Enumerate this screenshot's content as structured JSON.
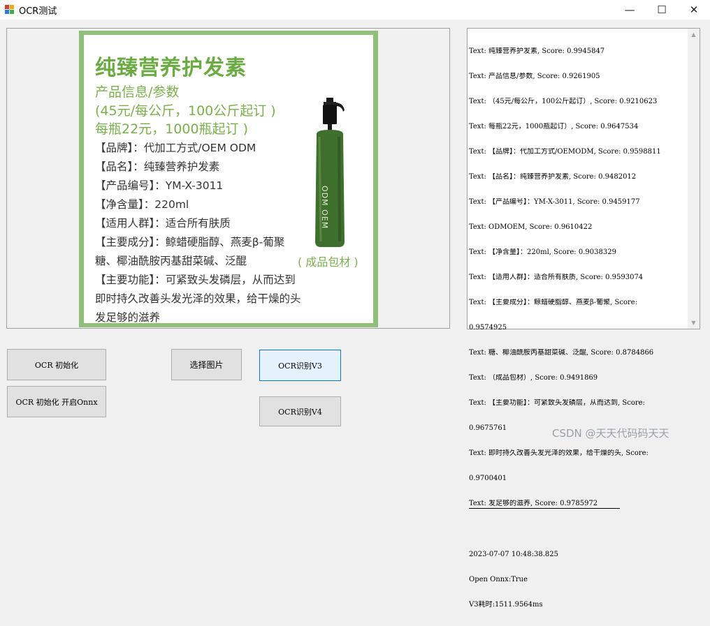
{
  "window": {
    "title": "OCR测试",
    "controls": {
      "minimize": "—",
      "maximize": "☐",
      "close": "✕"
    }
  },
  "product_image": {
    "title": "纯臻营养护发素",
    "sub1": "产品信息/参数",
    "sub2": "(45元/每公斤，100公斤起订 )",
    "sub3": "每瓶22元，1000瓶起订 )",
    "lines": [
      "【品牌】：代加工方式/OEM ODM",
      "【品名】：纯臻营养护发素",
      "【产品编号】：YM-X-3011",
      "【净含量】：220ml",
      "【适用人群】：适合所有肤质",
      "【主要成分】：鲸蜡硬脂醇、燕麦β-葡聚",
      "糖、椰油酰胺丙基甜菜碱、泛醌",
      "【主要功能】：可紧致头发磷层，从而达到",
      "即时持久改善头发光泽的效果，给干燥的头",
      "发足够的滋养"
    ],
    "bottle_label": "ODM OEM",
    "pack_label": "( 成品包材 )"
  },
  "results": {
    "lines": [
      "Text: 纯臻营养护发素, Score: 0.9945847",
      "Text: 产品信息/参数, Score: 0.9261905",
      "Text: （45元/每公斤，100公斤起订）, Score: 0.9210623",
      "Text: 每瓶22元，1000瓶起订）, Score: 0.9647534",
      "Text: 【品牌】：代加工方式/OEMODM, Score: 0.9598811",
      "Text: 【品名】：纯臻营养护发素, Score: 0.9482012",
      "Text: 【产品编号】：YM-X-3011, Score: 0.9459177",
      "Text: ODMOEM, Score: 0.9610422",
      "Text: 【净含量】：220ml, Score: 0.9038329",
      "Text: 【适用人群】：适合所有肤质, Score: 0.9593074",
      "Text: 【主要成分】：鲸蜡硬脂醇、燕麦β-葡聚, Score:",
      "0.9574925",
      "Text: 糖、椰油酰胺丙基甜菜碱、泛醌, Score: 0.8784866",
      "Text: （成品包材）, Score: 0.9491869",
      "Text: 【主要功能】：可紧致头发磷层，从而达到, Score:",
      "0.9675761",
      "Text: 即时持久改善头发光泽的效果，给干燥的头, Score:",
      "0.9700401",
      "Text: 发足够的滋养, Score: 0.9785972"
    ],
    "timestamp": "2023-07-07 10:48:38.825",
    "onnx_status": "Open Onnx:True",
    "v3_time": "V3耗时:1511.9564ms"
  },
  "buttons": {
    "init": "OCR 初始化",
    "init_onnx": "OCR 初始化 开启Onnx",
    "select_image": "选择图片",
    "recognize_v3": "OCR识别V3",
    "recognize_v4": "OCR识别V4"
  },
  "watermark": "CSDN @天天代码码天天",
  "colors": {
    "accent": "#0078d7",
    "product_green": "#6cab43"
  }
}
